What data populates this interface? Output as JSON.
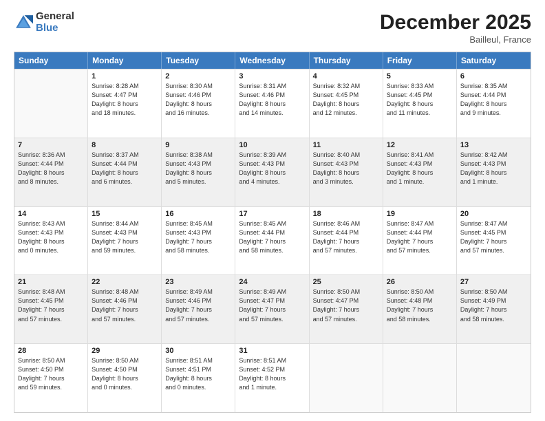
{
  "logo": {
    "general": "General",
    "blue": "Blue"
  },
  "title": "December 2025",
  "location": "Bailleul, France",
  "days_header": [
    "Sunday",
    "Monday",
    "Tuesday",
    "Wednesday",
    "Thursday",
    "Friday",
    "Saturday"
  ],
  "weeks": [
    [
      {
        "day": "",
        "info": ""
      },
      {
        "day": "1",
        "info": "Sunrise: 8:28 AM\nSunset: 4:47 PM\nDaylight: 8 hours\nand 18 minutes."
      },
      {
        "day": "2",
        "info": "Sunrise: 8:30 AM\nSunset: 4:46 PM\nDaylight: 8 hours\nand 16 minutes."
      },
      {
        "day": "3",
        "info": "Sunrise: 8:31 AM\nSunset: 4:46 PM\nDaylight: 8 hours\nand 14 minutes."
      },
      {
        "day": "4",
        "info": "Sunrise: 8:32 AM\nSunset: 4:45 PM\nDaylight: 8 hours\nand 12 minutes."
      },
      {
        "day": "5",
        "info": "Sunrise: 8:33 AM\nSunset: 4:45 PM\nDaylight: 8 hours\nand 11 minutes."
      },
      {
        "day": "6",
        "info": "Sunrise: 8:35 AM\nSunset: 4:44 PM\nDaylight: 8 hours\nand 9 minutes."
      }
    ],
    [
      {
        "day": "7",
        "info": "Sunrise: 8:36 AM\nSunset: 4:44 PM\nDaylight: 8 hours\nand 8 minutes."
      },
      {
        "day": "8",
        "info": "Sunrise: 8:37 AM\nSunset: 4:44 PM\nDaylight: 8 hours\nand 6 minutes."
      },
      {
        "day": "9",
        "info": "Sunrise: 8:38 AM\nSunset: 4:43 PM\nDaylight: 8 hours\nand 5 minutes."
      },
      {
        "day": "10",
        "info": "Sunrise: 8:39 AM\nSunset: 4:43 PM\nDaylight: 8 hours\nand 4 minutes."
      },
      {
        "day": "11",
        "info": "Sunrise: 8:40 AM\nSunset: 4:43 PM\nDaylight: 8 hours\nand 3 minutes."
      },
      {
        "day": "12",
        "info": "Sunrise: 8:41 AM\nSunset: 4:43 PM\nDaylight: 8 hours\nand 1 minute."
      },
      {
        "day": "13",
        "info": "Sunrise: 8:42 AM\nSunset: 4:43 PM\nDaylight: 8 hours\nand 1 minute."
      }
    ],
    [
      {
        "day": "14",
        "info": "Sunrise: 8:43 AM\nSunset: 4:43 PM\nDaylight: 8 hours\nand 0 minutes."
      },
      {
        "day": "15",
        "info": "Sunrise: 8:44 AM\nSunset: 4:43 PM\nDaylight: 7 hours\nand 59 minutes."
      },
      {
        "day": "16",
        "info": "Sunrise: 8:45 AM\nSunset: 4:43 PM\nDaylight: 7 hours\nand 58 minutes."
      },
      {
        "day": "17",
        "info": "Sunrise: 8:45 AM\nSunset: 4:44 PM\nDaylight: 7 hours\nand 58 minutes."
      },
      {
        "day": "18",
        "info": "Sunrise: 8:46 AM\nSunset: 4:44 PM\nDaylight: 7 hours\nand 57 minutes."
      },
      {
        "day": "19",
        "info": "Sunrise: 8:47 AM\nSunset: 4:44 PM\nDaylight: 7 hours\nand 57 minutes."
      },
      {
        "day": "20",
        "info": "Sunrise: 8:47 AM\nSunset: 4:45 PM\nDaylight: 7 hours\nand 57 minutes."
      }
    ],
    [
      {
        "day": "21",
        "info": "Sunrise: 8:48 AM\nSunset: 4:45 PM\nDaylight: 7 hours\nand 57 minutes."
      },
      {
        "day": "22",
        "info": "Sunrise: 8:48 AM\nSunset: 4:46 PM\nDaylight: 7 hours\nand 57 minutes."
      },
      {
        "day": "23",
        "info": "Sunrise: 8:49 AM\nSunset: 4:46 PM\nDaylight: 7 hours\nand 57 minutes."
      },
      {
        "day": "24",
        "info": "Sunrise: 8:49 AM\nSunset: 4:47 PM\nDaylight: 7 hours\nand 57 minutes."
      },
      {
        "day": "25",
        "info": "Sunrise: 8:50 AM\nSunset: 4:47 PM\nDaylight: 7 hours\nand 57 minutes."
      },
      {
        "day": "26",
        "info": "Sunrise: 8:50 AM\nSunset: 4:48 PM\nDaylight: 7 hours\nand 58 minutes."
      },
      {
        "day": "27",
        "info": "Sunrise: 8:50 AM\nSunset: 4:49 PM\nDaylight: 7 hours\nand 58 minutes."
      }
    ],
    [
      {
        "day": "28",
        "info": "Sunrise: 8:50 AM\nSunset: 4:50 PM\nDaylight: 7 hours\nand 59 minutes."
      },
      {
        "day": "29",
        "info": "Sunrise: 8:50 AM\nSunset: 4:50 PM\nDaylight: 8 hours\nand 0 minutes."
      },
      {
        "day": "30",
        "info": "Sunrise: 8:51 AM\nSunset: 4:51 PM\nDaylight: 8 hours\nand 0 minutes."
      },
      {
        "day": "31",
        "info": "Sunrise: 8:51 AM\nSunset: 4:52 PM\nDaylight: 8 hours\nand 1 minute."
      },
      {
        "day": "",
        "info": ""
      },
      {
        "day": "",
        "info": ""
      },
      {
        "day": "",
        "info": ""
      }
    ]
  ]
}
